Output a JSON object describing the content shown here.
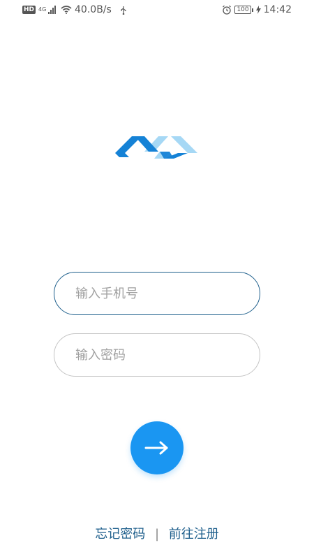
{
  "status_bar": {
    "hd": "HD",
    "network_type": "4G",
    "speed": "40.0B/s",
    "battery": "100",
    "time": "14:42"
  },
  "login": {
    "phone_placeholder": "输入手机号",
    "password_placeholder": "输入密码",
    "submit_icon": "arrow-right-icon"
  },
  "links": {
    "forgot_password": "忘记密码",
    "separator": "|",
    "register": "前往注册"
  },
  "colors": {
    "accent": "#1a96f2",
    "logo_dark": "#1582d6",
    "logo_light": "#a6d8f5",
    "link": "#1e5f8c"
  }
}
